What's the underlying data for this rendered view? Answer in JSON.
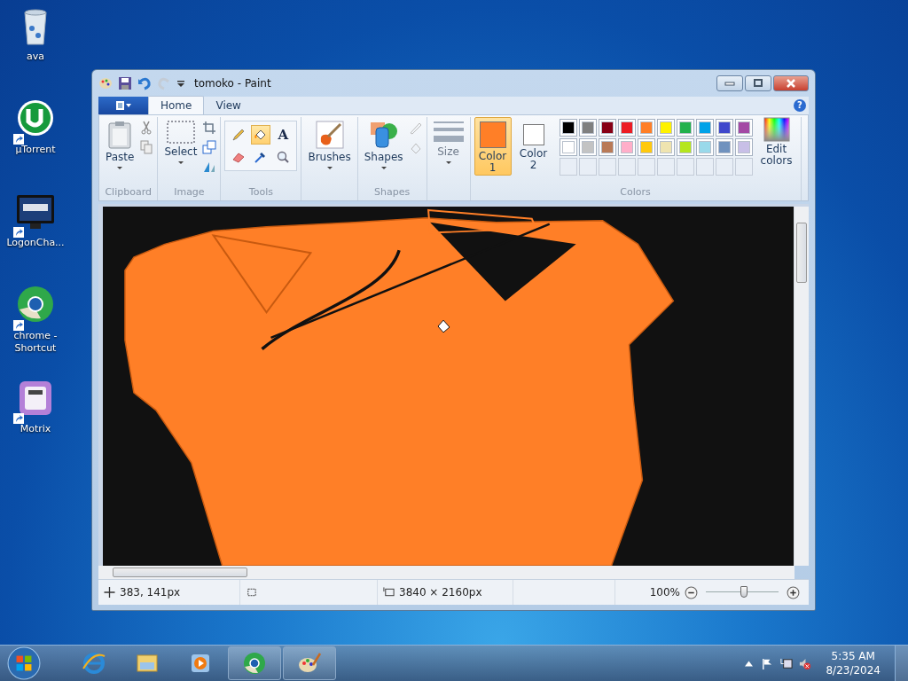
{
  "desktop_icons": [
    {
      "label": "ava",
      "kind": "recycle",
      "shortcut": false
    },
    {
      "label": "µTorrent",
      "kind": "utorrent",
      "shortcut": true
    },
    {
      "label": "LogonCha...",
      "kind": "logon",
      "shortcut": true
    },
    {
      "label": "chrome - Shortcut",
      "kind": "chrome",
      "shortcut": true
    },
    {
      "label": "Motrix",
      "kind": "motrix",
      "shortcut": true
    }
  ],
  "window": {
    "title": "tomoko - Paint",
    "help": "?"
  },
  "ribbon_tabs": [
    {
      "label": "Home",
      "selected": true
    },
    {
      "label": "View",
      "selected": false
    }
  ],
  "clipboard": {
    "paste": "Paste",
    "label": "Clipboard"
  },
  "image": {
    "select": "Select",
    "label": "Image"
  },
  "tools": {
    "label": "Tools",
    "items": [
      {
        "kind": "pencil",
        "selected": false
      },
      {
        "kind": "fill",
        "selected": true
      },
      {
        "kind": "text",
        "label": "A",
        "selected": false
      },
      {
        "kind": "eraser",
        "selected": false
      },
      {
        "kind": "picker",
        "selected": false
      },
      {
        "kind": "magnifier",
        "selected": false
      }
    ]
  },
  "brushes": {
    "label": "Brushes"
  },
  "shapes": {
    "button": "Shapes",
    "label": "Shapes"
  },
  "size": {
    "label": "Size",
    "disabled": true
  },
  "colors": {
    "label": "Colors",
    "edit": "Edit colors",
    "slots": [
      {
        "label": "Color 1",
        "color": "#ff7f27",
        "selected": true
      },
      {
        "label": "Color 2",
        "color": "#ffffff",
        "selected": false
      }
    ],
    "palette": [
      {
        "color": "#000000"
      },
      {
        "color": "#7f7f7f"
      },
      {
        "color": "#880015"
      },
      {
        "color": "#ed1c24"
      },
      {
        "color": "#ff7f27"
      },
      {
        "color": "#fff200"
      },
      {
        "color": "#22b14c"
      },
      {
        "color": "#00a2e8"
      },
      {
        "color": "#3f48cc"
      },
      {
        "color": "#a349a4"
      },
      {
        "color": "#ffffff"
      },
      {
        "color": "#c3c3c3"
      },
      {
        "color": "#b97a57"
      },
      {
        "color": "#ffaec9"
      },
      {
        "color": "#ffc90e"
      },
      {
        "color": "#efe4b0"
      },
      {
        "color": "#b5e61d"
      },
      {
        "color": "#99d9ea"
      },
      {
        "color": "#7092be"
      },
      {
        "color": "#c8bfe7"
      }
    ]
  },
  "status_bar": {
    "position": "383, 141px",
    "size": "3840 × 2160px",
    "zoom": "100%",
    "zoom_level": {
      "level": 0.52
    }
  },
  "taskbar": {
    "items": [
      {
        "kind": "ie",
        "running": false
      },
      {
        "kind": "explorer",
        "running": false
      },
      {
        "kind": "media",
        "running": false
      },
      {
        "kind": "chrome",
        "running": true
      },
      {
        "kind": "paint",
        "running": true
      }
    ],
    "time": "5:35 AM",
    "date": "8/23/2024"
  }
}
